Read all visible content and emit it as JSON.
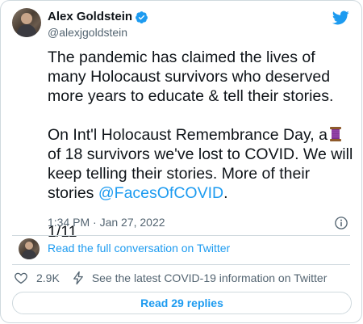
{
  "author": {
    "display_name": "Alex Goldstein",
    "handle": "@alexjgoldstein",
    "verified": true
  },
  "tweet": {
    "line1": "The pandemic has claimed the lives of many Holocaust survivors who deserved more years to educate & tell their stories.",
    "para2_before": "On Int'l Holocaust Remembrance Day, a",
    "para2_after": "of 18 survivors we've lost to COVID. We will keep telling their stories. More of their stories",
    "mention": "@FacesOfCOVID",
    "mention_suffix": ".",
    "thread_counter": "1/11",
    "timestamp": "1:34 PM · Jan 27, 2022"
  },
  "conversation_link": "Read the full conversation on Twitter",
  "actions": {
    "like_count": "2.9K",
    "covid_info": "See the latest COVID-19 information on Twitter"
  },
  "read_replies": "Read 29 replies",
  "colors": {
    "accent": "#1d9bf0",
    "text": "#0f1419",
    "secondary_text": "#536471",
    "border": "#cfd9de"
  },
  "icons": [
    "verified-badge-icon",
    "twitter-bird-icon",
    "thread-spool-emoji-icon",
    "info-icon",
    "heart-icon",
    "lightning-icon"
  ]
}
